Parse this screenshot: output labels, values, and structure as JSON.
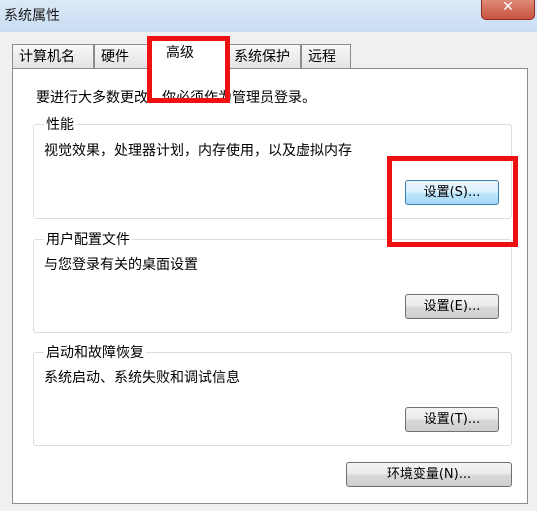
{
  "window": {
    "title": "系统属性",
    "close_glyph": "✕"
  },
  "tabs": [
    {
      "label": "计算机名",
      "active": false
    },
    {
      "label": "硬件",
      "active": false
    },
    {
      "label": "高级",
      "active": true
    },
    {
      "label": "系统保护",
      "active": false
    },
    {
      "label": "远程",
      "active": false
    }
  ],
  "admin_note": "要进行大多数更改，你必须作为管理员登录。",
  "groups": {
    "performance": {
      "title": "性能",
      "description": "视觉效果，处理器计划，内存使用，以及虚拟内存",
      "button": "设置(S)..."
    },
    "user_profiles": {
      "title": "用户配置文件",
      "description": "与您登录有关的桌面设置",
      "button": "设置(E)..."
    },
    "startup_recovery": {
      "title": "启动和故障恢复",
      "description": "系统启动、系统失败和调试信息",
      "button": "设置(T)..."
    }
  },
  "env_button": "环境变量(N)...",
  "colors": {
    "highlight": "#ee1111",
    "focus_border": "#3c7fb1"
  }
}
